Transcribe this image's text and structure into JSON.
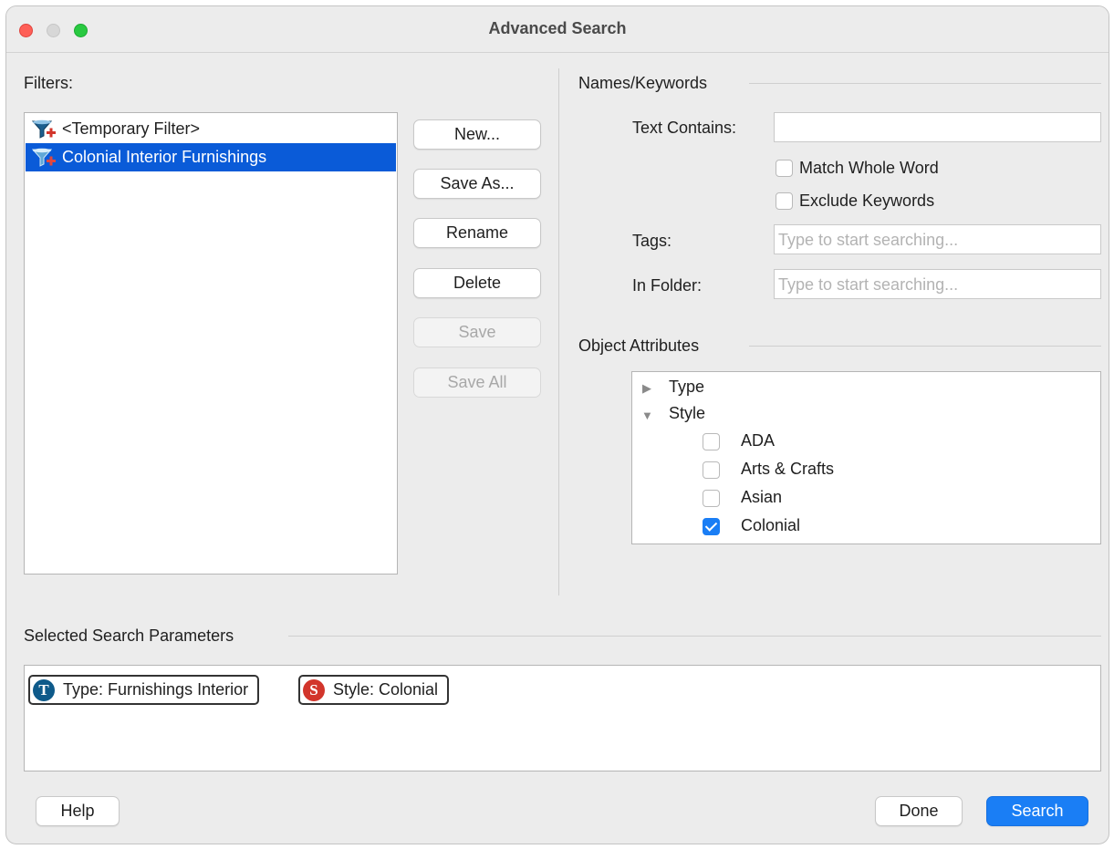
{
  "window": {
    "title": "Advanced Search"
  },
  "filters": {
    "label": "Filters:",
    "items": [
      {
        "label": "<Temporary Filter>",
        "icon": "funnel-add-icon",
        "selected": false
      },
      {
        "label": "Colonial Interior Furnishings",
        "icon": "funnel-add-icon",
        "selected": true
      }
    ],
    "buttons": {
      "new": "New...",
      "save_as": "Save As...",
      "rename": "Rename",
      "delete": "Delete",
      "save": "Save",
      "save_all": "Save All"
    }
  },
  "names_keywords": {
    "section_label": "Names/Keywords",
    "text_contains_label": "Text Contains:",
    "text_contains_value": "",
    "match_whole_word_label": "Match Whole Word",
    "match_whole_word_checked": false,
    "exclude_keywords_label": "Exclude Keywords",
    "exclude_keywords_checked": false,
    "tags_label": "Tags:",
    "tags_placeholder": "Type to start searching...",
    "folder_label": "In Folder:",
    "folder_placeholder": "Type to start searching..."
  },
  "object_attributes": {
    "section_label": "Object Attributes",
    "tree": [
      {
        "label": "Type",
        "expanded": false
      },
      {
        "label": "Style",
        "expanded": true,
        "children": [
          {
            "label": "ADA",
            "checked": false
          },
          {
            "label": "Arts & Crafts",
            "checked": false
          },
          {
            "label": "Asian",
            "checked": false
          },
          {
            "label": "Colonial",
            "checked": true
          }
        ]
      }
    ]
  },
  "selected_params": {
    "section_label": "Selected Search Parameters",
    "chips": [
      {
        "letter": "T",
        "label": "Type: Furnishings Interior",
        "color": "#0e5a8a"
      },
      {
        "letter": "S",
        "label": "Style: Colonial",
        "color": "#d2352b"
      }
    ]
  },
  "footer": {
    "help": "Help",
    "done": "Done",
    "search": "Search"
  },
  "colors": {
    "accent": "#1a7ef5",
    "selection": "#0a5bd8"
  }
}
